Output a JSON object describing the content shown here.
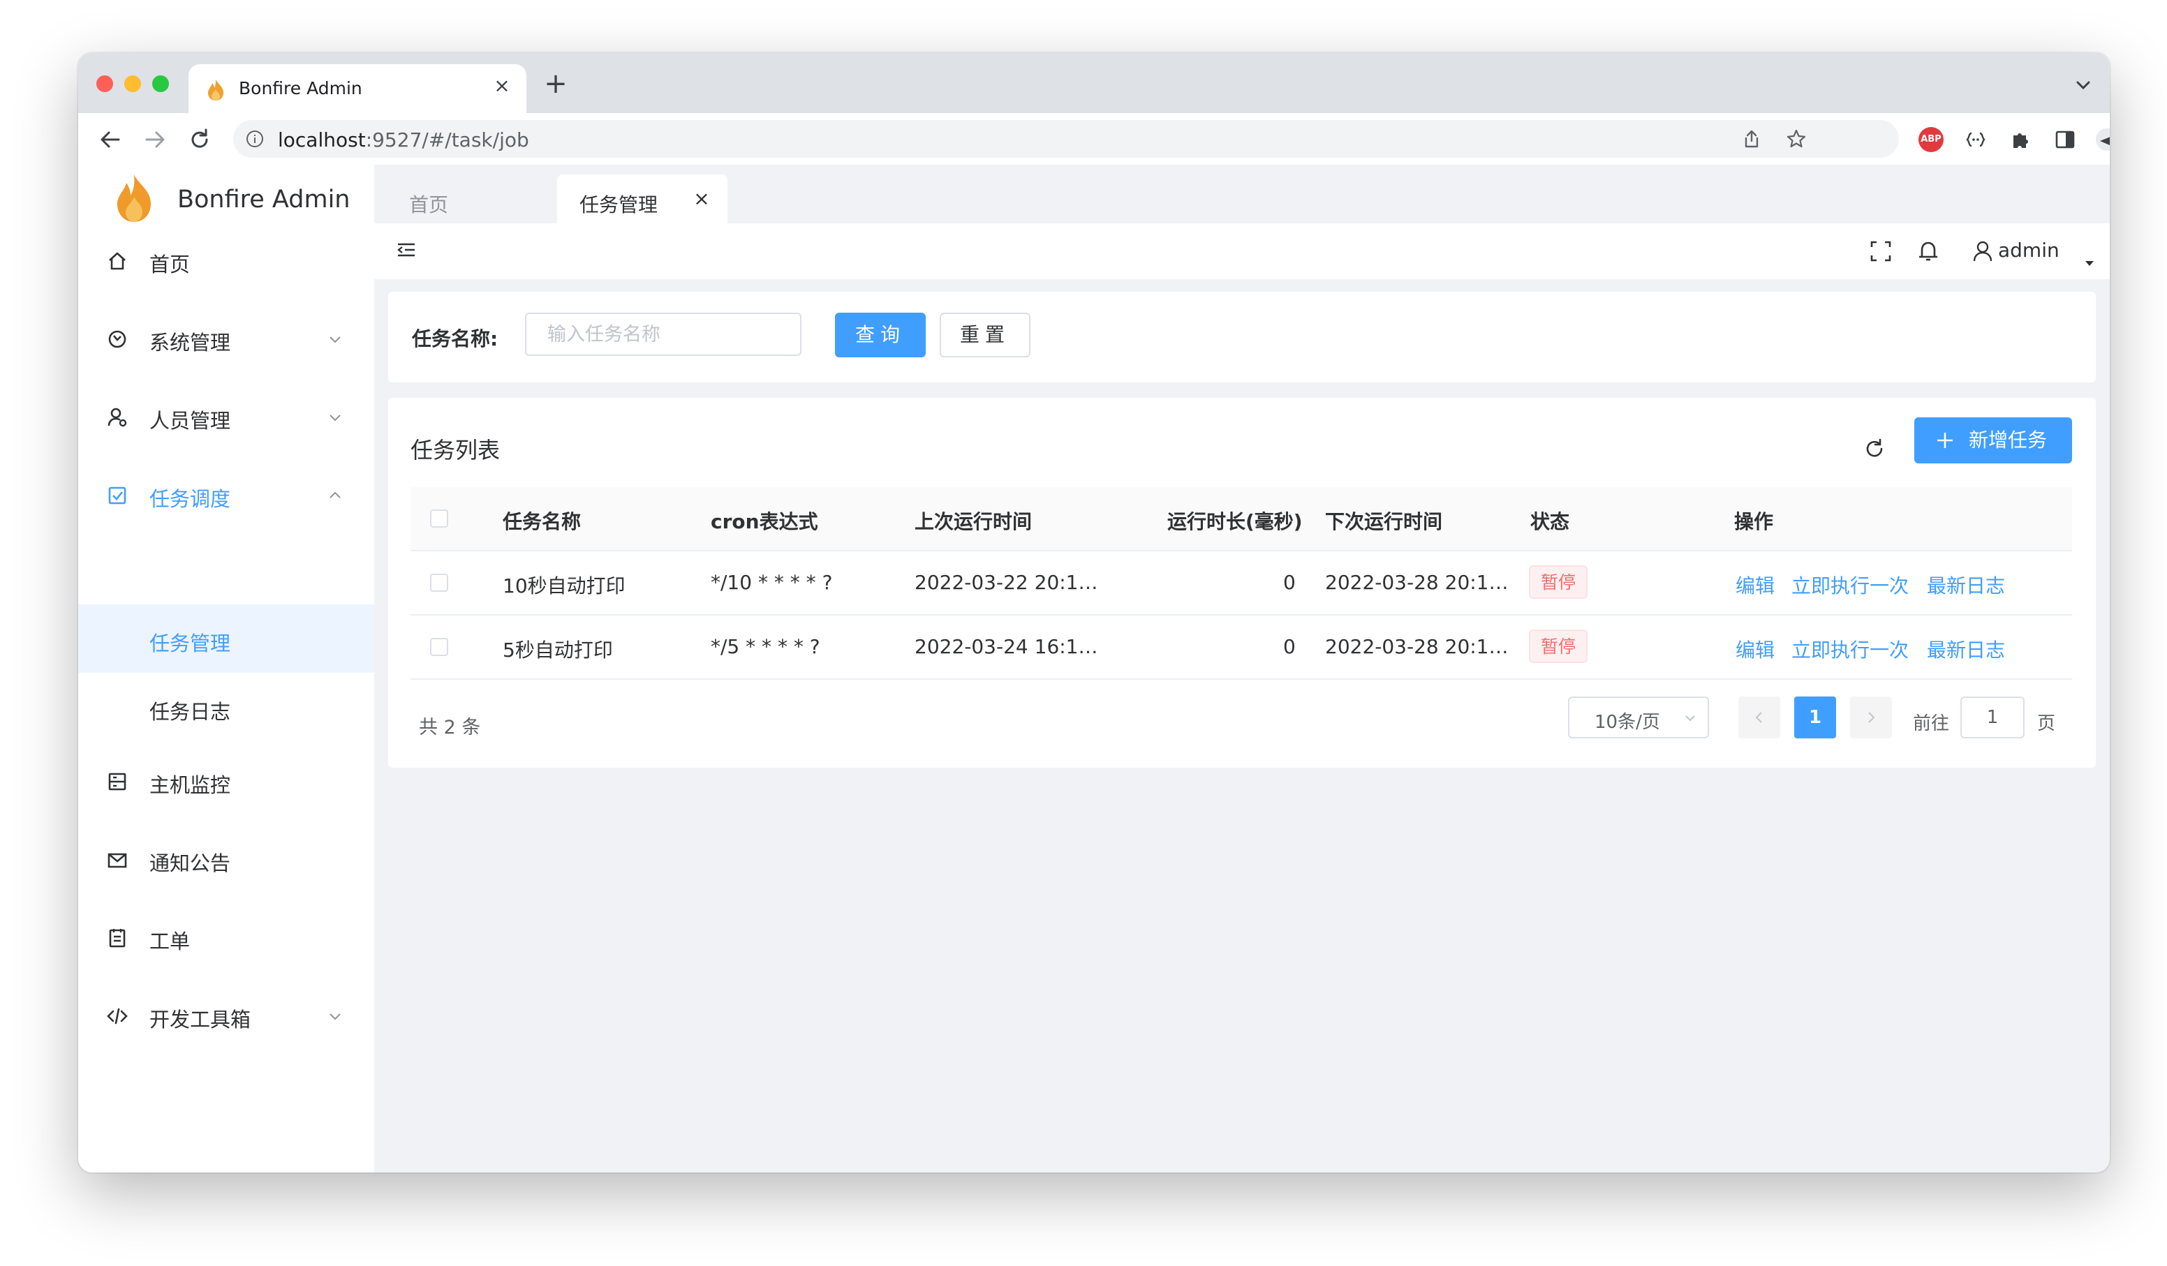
{
  "browser": {
    "tab_title": "Bonfire Admin",
    "url_host": "localhost",
    "url_rest": ":9527/#/task/job",
    "ext_abp_label": "ABP"
  },
  "sidebar": {
    "brand": "Bonfire Admin",
    "items": [
      {
        "label": "首页",
        "icon": "home-icon"
      },
      {
        "label": "系统管理",
        "icon": "system-icon"
      },
      {
        "label": "人员管理",
        "icon": "user-manage-icon"
      },
      {
        "label": "任务调度",
        "icon": "task-schedule-icon"
      },
      {
        "label": "主机监控",
        "icon": "host-monitor-icon"
      },
      {
        "label": "通知公告",
        "icon": "notice-icon"
      },
      {
        "label": "工单",
        "icon": "ticket-icon"
      },
      {
        "label": "开发工具箱",
        "icon": "devtools-icon"
      }
    ],
    "sub_items": [
      {
        "label": "任务管理"
      },
      {
        "label": "任务日志"
      }
    ]
  },
  "tags": {
    "home": "首页",
    "current": "任务管理"
  },
  "navbar": {
    "username": "admin"
  },
  "search": {
    "label": "任务名称:",
    "placeholder": "输入任务名称",
    "query_button": "查询",
    "reset_button": "重置"
  },
  "list": {
    "title": "任务列表",
    "add_button": "新增任务",
    "columns": [
      "任务名称",
      "cron表达式",
      "上次运行时间",
      "运行时长(毫秒)",
      "下次运行时间",
      "状态",
      "操作"
    ],
    "rows": [
      {
        "name": "10秒自动打印",
        "cron": "*/10 * * * * ?",
        "last_run": "2022-03-22 20:1…",
        "duration": "0",
        "next_run": "2022-03-28 20:1…",
        "status": "暂停"
      },
      {
        "name": "5秒自动打印",
        "cron": "*/5 * * * * ?",
        "last_run": "2022-03-24 16:1…",
        "duration": "0",
        "next_run": "2022-03-28 20:1…",
        "status": "暂停"
      }
    ],
    "actions": {
      "edit": "编辑",
      "run_once": "立即执行一次",
      "latest_log": "最新日志"
    }
  },
  "pagination": {
    "total_text": "共 2 条",
    "page_size": "10条/页",
    "current_page": "1",
    "goto_label": "前往",
    "goto_value": "1",
    "goto_suffix": "页"
  },
  "colors": {
    "primary": "#409eff",
    "danger": "#f56c6c",
    "sidebar_active_bg": "#ecf5ff",
    "page_bg": "#f0f2f5"
  }
}
